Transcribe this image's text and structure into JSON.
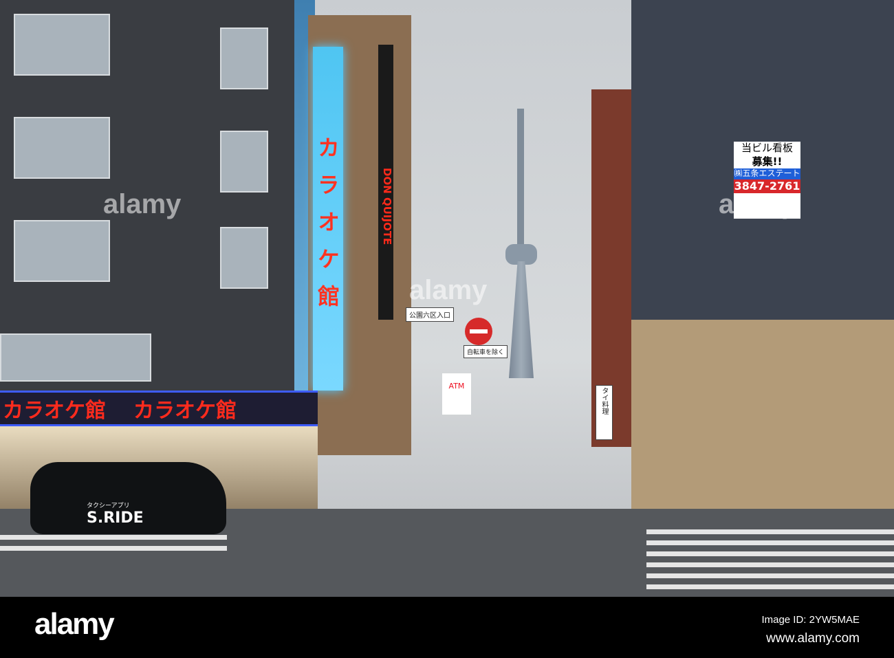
{
  "scene": {
    "karaoke_vertical": "カラオケ館",
    "karaoke_banner": [
      "カラオケ館",
      "カラオケ館"
    ],
    "don_quijote": "DON QUIJOTE",
    "street_sign": "公園六区入口",
    "bicycle_sign": "自転車を除く",
    "atm": "ATM",
    "thai_food": "タイ料理",
    "billboard": {
      "line1": "当ビル看板",
      "line2": "募集!!",
      "line3": "㈱五条エステート",
      "line4": "3847-2761"
    },
    "taxi": {
      "app": "タクシーアプリ",
      "brand": "S.RIDE"
    }
  },
  "watermark": "alamy",
  "footer": {
    "logo": "alamy",
    "image_id": "Image ID: 2YW5MAE",
    "url": "www.alamy.com"
  }
}
